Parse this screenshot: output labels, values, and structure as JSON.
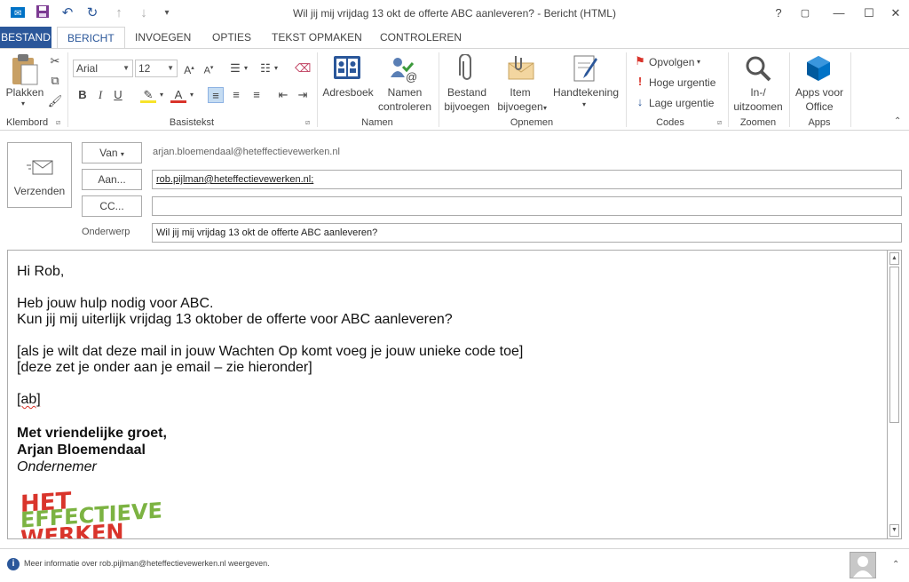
{
  "window": {
    "title": "Wil jij mij vrijdag 13 okt de offerte ABC aanleveren? - Bericht (HTML)",
    "help": "?",
    "restore_ribbon": "▢",
    "minimize": "—",
    "maximize": "☐",
    "close": "✕"
  },
  "tabs": [
    "BESTAND",
    "BERICHT",
    "INVOEGEN",
    "OPTIES",
    "TEKST OPMAKEN",
    "CONTROLEREN"
  ],
  "ribbon": {
    "klembord": {
      "label": "Klembord",
      "paste": "Plakken"
    },
    "basistekst": {
      "label": "Basistekst",
      "font": "Arial",
      "size": "12",
      "bold": "B",
      "italic": "I",
      "underline": "U"
    },
    "namen": {
      "label": "Namen",
      "adresboek": "Adresboek",
      "namen_line1": "Namen",
      "namen_line2": "controleren"
    },
    "opnemen": {
      "label": "Opnemen",
      "bestand_line1": "Bestand",
      "bestand_line2": "bijvoegen",
      "item_line1": "Item",
      "item_line2": "bijvoegen",
      "handtekening": "Handtekening"
    },
    "codes": {
      "label": "Codes",
      "opvolgen": "Opvolgen",
      "hoge": "Hoge urgentie",
      "lage": "Lage urgentie"
    },
    "zoomen": {
      "label": "Zoomen",
      "line1": "In-/",
      "line2": "uitzoomen"
    },
    "apps": {
      "label": "Apps",
      "line1": "Apps voor",
      "line2": "Office"
    }
  },
  "compose": {
    "send": "Verzenden",
    "van_button": "Van",
    "van_value": "arjan.bloemendaal@heteffectievewerken.nl",
    "aan_button": "Aan...",
    "aan_value": "rob.pijlman@heteffectievewerken.nl;",
    "cc_button": "CC...",
    "cc_value": "",
    "subject_label": "Onderwerp",
    "subject_value": "Wil jij mij vrijdag 13 okt de offerte ABC aanleveren?"
  },
  "body": {
    "greeting": "Hi Rob,",
    "line1": "Heb jouw hulp nodig voor ABC.",
    "line2": "Kun jij mij uiterlijk vrijdag 13 oktober de offerte voor ABC aanleveren?",
    "note1": "[als je wilt dat deze mail in jouw Wachten Op komt voeg je jouw unieke code toe]",
    "note2": "[deze zet je onder aan je email – zie hieronder]",
    "code": "[ab]",
    "closing": "Met vriendelijke groet,",
    "name": "Arjan Bloemendaal",
    "role": "Ondernemer",
    "logo_line1": "HET",
    "logo_line2": "EFFECTIEVE",
    "logo_line3": "WERKEN"
  },
  "status": {
    "text": "Meer informatie over rob.pijlman@heteffectievewerken.nl weergeven."
  },
  "colors": {
    "accent": "#2b579a",
    "logo_red": "#d9342b",
    "logo_green": "#7cb342"
  }
}
